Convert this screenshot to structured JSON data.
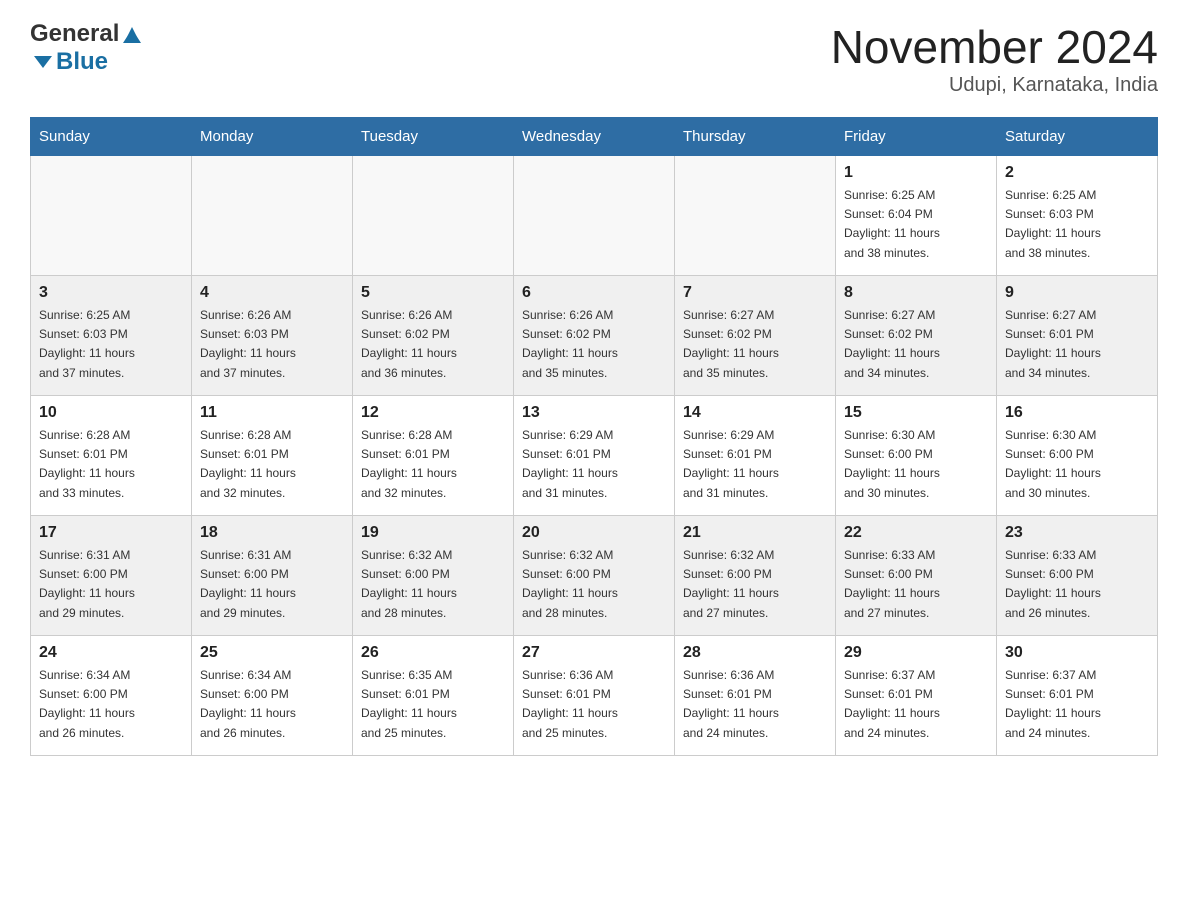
{
  "header": {
    "logo_general": "General",
    "logo_blue": "Blue",
    "month_title": "November 2024",
    "subtitle": "Udupi, Karnataka, India"
  },
  "weekdays": [
    "Sunday",
    "Monday",
    "Tuesday",
    "Wednesday",
    "Thursday",
    "Friday",
    "Saturday"
  ],
  "rows": [
    [
      {
        "date": "",
        "info": ""
      },
      {
        "date": "",
        "info": ""
      },
      {
        "date": "",
        "info": ""
      },
      {
        "date": "",
        "info": ""
      },
      {
        "date": "",
        "info": ""
      },
      {
        "date": "1",
        "info": "Sunrise: 6:25 AM\nSunset: 6:04 PM\nDaylight: 11 hours\nand 38 minutes."
      },
      {
        "date": "2",
        "info": "Sunrise: 6:25 AM\nSunset: 6:03 PM\nDaylight: 11 hours\nand 38 minutes."
      }
    ],
    [
      {
        "date": "3",
        "info": "Sunrise: 6:25 AM\nSunset: 6:03 PM\nDaylight: 11 hours\nand 37 minutes."
      },
      {
        "date": "4",
        "info": "Sunrise: 6:26 AM\nSunset: 6:03 PM\nDaylight: 11 hours\nand 37 minutes."
      },
      {
        "date": "5",
        "info": "Sunrise: 6:26 AM\nSunset: 6:02 PM\nDaylight: 11 hours\nand 36 minutes."
      },
      {
        "date": "6",
        "info": "Sunrise: 6:26 AM\nSunset: 6:02 PM\nDaylight: 11 hours\nand 35 minutes."
      },
      {
        "date": "7",
        "info": "Sunrise: 6:27 AM\nSunset: 6:02 PM\nDaylight: 11 hours\nand 35 minutes."
      },
      {
        "date": "8",
        "info": "Sunrise: 6:27 AM\nSunset: 6:02 PM\nDaylight: 11 hours\nand 34 minutes."
      },
      {
        "date": "9",
        "info": "Sunrise: 6:27 AM\nSunset: 6:01 PM\nDaylight: 11 hours\nand 34 minutes."
      }
    ],
    [
      {
        "date": "10",
        "info": "Sunrise: 6:28 AM\nSunset: 6:01 PM\nDaylight: 11 hours\nand 33 minutes."
      },
      {
        "date": "11",
        "info": "Sunrise: 6:28 AM\nSunset: 6:01 PM\nDaylight: 11 hours\nand 32 minutes."
      },
      {
        "date": "12",
        "info": "Sunrise: 6:28 AM\nSunset: 6:01 PM\nDaylight: 11 hours\nand 32 minutes."
      },
      {
        "date": "13",
        "info": "Sunrise: 6:29 AM\nSunset: 6:01 PM\nDaylight: 11 hours\nand 31 minutes."
      },
      {
        "date": "14",
        "info": "Sunrise: 6:29 AM\nSunset: 6:01 PM\nDaylight: 11 hours\nand 31 minutes."
      },
      {
        "date": "15",
        "info": "Sunrise: 6:30 AM\nSunset: 6:00 PM\nDaylight: 11 hours\nand 30 minutes."
      },
      {
        "date": "16",
        "info": "Sunrise: 6:30 AM\nSunset: 6:00 PM\nDaylight: 11 hours\nand 30 minutes."
      }
    ],
    [
      {
        "date": "17",
        "info": "Sunrise: 6:31 AM\nSunset: 6:00 PM\nDaylight: 11 hours\nand 29 minutes."
      },
      {
        "date": "18",
        "info": "Sunrise: 6:31 AM\nSunset: 6:00 PM\nDaylight: 11 hours\nand 29 minutes."
      },
      {
        "date": "19",
        "info": "Sunrise: 6:32 AM\nSunset: 6:00 PM\nDaylight: 11 hours\nand 28 minutes."
      },
      {
        "date": "20",
        "info": "Sunrise: 6:32 AM\nSunset: 6:00 PM\nDaylight: 11 hours\nand 28 minutes."
      },
      {
        "date": "21",
        "info": "Sunrise: 6:32 AM\nSunset: 6:00 PM\nDaylight: 11 hours\nand 27 minutes."
      },
      {
        "date": "22",
        "info": "Sunrise: 6:33 AM\nSunset: 6:00 PM\nDaylight: 11 hours\nand 27 minutes."
      },
      {
        "date": "23",
        "info": "Sunrise: 6:33 AM\nSunset: 6:00 PM\nDaylight: 11 hours\nand 26 minutes."
      }
    ],
    [
      {
        "date": "24",
        "info": "Sunrise: 6:34 AM\nSunset: 6:00 PM\nDaylight: 11 hours\nand 26 minutes."
      },
      {
        "date": "25",
        "info": "Sunrise: 6:34 AM\nSunset: 6:00 PM\nDaylight: 11 hours\nand 26 minutes."
      },
      {
        "date": "26",
        "info": "Sunrise: 6:35 AM\nSunset: 6:01 PM\nDaylight: 11 hours\nand 25 minutes."
      },
      {
        "date": "27",
        "info": "Sunrise: 6:36 AM\nSunset: 6:01 PM\nDaylight: 11 hours\nand 25 minutes."
      },
      {
        "date": "28",
        "info": "Sunrise: 6:36 AM\nSunset: 6:01 PM\nDaylight: 11 hours\nand 24 minutes."
      },
      {
        "date": "29",
        "info": "Sunrise: 6:37 AM\nSunset: 6:01 PM\nDaylight: 11 hours\nand 24 minutes."
      },
      {
        "date": "30",
        "info": "Sunrise: 6:37 AM\nSunset: 6:01 PM\nDaylight: 11 hours\nand 24 minutes."
      }
    ]
  ]
}
